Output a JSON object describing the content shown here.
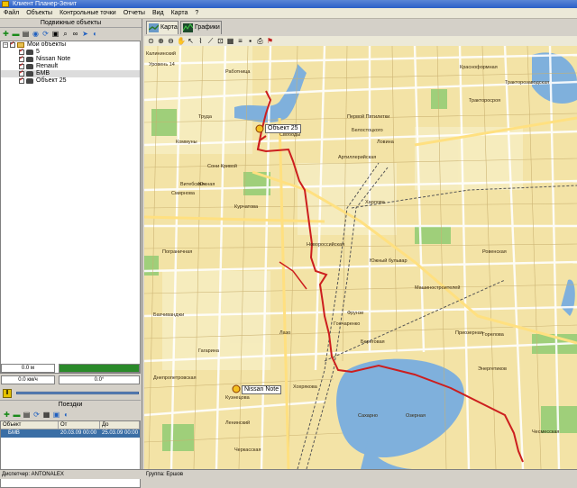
{
  "window": {
    "title": "Клиент Планер-Зенит"
  },
  "menu": [
    "Файл",
    "Объекты",
    "Контрольные точки",
    "Отчеты",
    "Вид",
    "Карта",
    "?"
  ],
  "left_panel": {
    "title": "Подвижные объекты",
    "tree": {
      "root": "Мои объекты",
      "items": [
        "5",
        "Nissan Note",
        "Renault",
        "БМВ",
        "Объект 25"
      ]
    },
    "speed": "0.0 м",
    "speed2": "0.0 км/ч",
    "angle": "0.0°"
  },
  "trips": {
    "title": "Поездки",
    "columns": [
      "Объект",
      "От",
      "До"
    ],
    "rows": [
      {
        "object": "БМВ",
        "from": "20.03.09 00:00",
        "to": "25.03.09 00:00"
      }
    ]
  },
  "tabs": [
    {
      "label": "Карта",
      "icon": "map-icon",
      "active": true
    },
    {
      "label": "Графики",
      "icon": "chart-icon",
      "active": false
    }
  ],
  "map": {
    "object_labels": [
      "Объект 25",
      "Nissan Note"
    ],
    "street_labels": [
      "Уровень 14",
      "Калининский",
      "Работница",
      "Труда",
      "Коммуны",
      "Сони Кривой",
      "Южная",
      "Витебская",
      "Смирнова",
      "Курчатова",
      "Свободы",
      "Первой Пятилетки",
      "Белостоцкого",
      "Ловина",
      "Артиллерийская",
      "Красноформная",
      "Тракторосроя",
      "Тракторозаводская",
      "Харлова",
      "Новороссийская",
      "Южный бульвар",
      "Гончаренко",
      "Приозерная",
      "Береговая",
      "Лазо",
      "Фрунзе",
      "Горелова",
      "Ровенская",
      "Хохрякова",
      "Кузнецова",
      "Сахарно",
      "Озерная",
      "Чесмесская",
      "Бахчиванджи",
      "Гагарина",
      "Ленинский",
      "Энергетиков",
      "Машиностроителей",
      "Днепропетровская",
      "Пограничная",
      "Черкасская"
    ]
  },
  "status": {
    "dispatcher": "Диспетчер: ANTONALEX",
    "group": "Группа: Ершов"
  }
}
